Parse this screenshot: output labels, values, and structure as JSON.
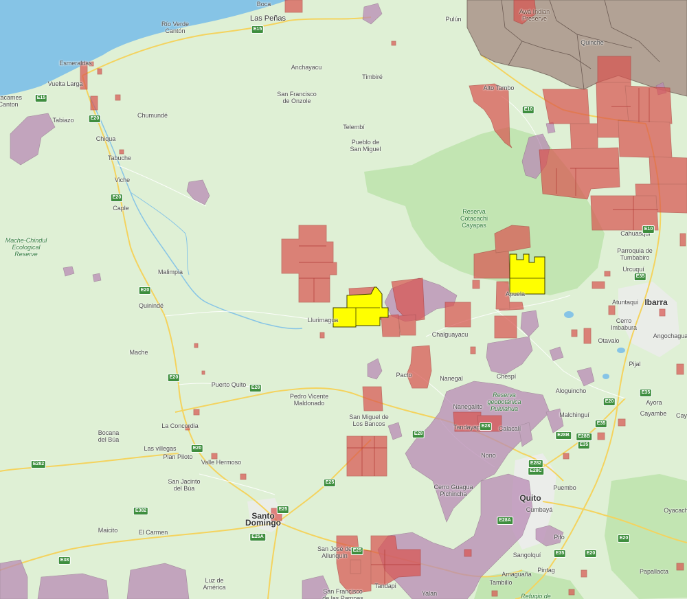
{
  "map": {
    "colors": {
      "land": "#dff0d5",
      "water": "#86c4e6",
      "park": "#bfe3ae",
      "road_major": "#f4d35e",
      "road_minor": "#ffffff",
      "mining_concession": "#d9534f",
      "protected_area": "#b98bb5",
      "indigenous_territory": "#a88f86",
      "highlight": "#ffff00",
      "urban": "#ececec"
    },
    "places": [
      {
        "text": "Las Peñas",
        "kind": "town"
      },
      {
        "text": "Río Verde\nCantón",
        "kind": "place"
      },
      {
        "text": "Esmeraldas",
        "kind": "place"
      },
      {
        "text": "Vuelta Larga",
        "kind": "place"
      },
      {
        "text": "Atacames\nCanton",
        "kind": "place"
      },
      {
        "text": "Tabiazo",
        "kind": "place"
      },
      {
        "text": "Chiqua",
        "kind": "place"
      },
      {
        "text": "Tabuche",
        "kind": "place"
      },
      {
        "text": "Viche",
        "kind": "place"
      },
      {
        "text": "Caple",
        "kind": "place"
      },
      {
        "text": "Anchayacu",
        "kind": "place"
      },
      {
        "text": "Timbiré",
        "kind": "place"
      },
      {
        "text": "San Francisco\nde Onzole",
        "kind": "place"
      },
      {
        "text": "Chumundé",
        "kind": "place"
      },
      {
        "text": "Telembí",
        "kind": "place"
      },
      {
        "text": "Pueblo de\nSan Miguel",
        "kind": "place"
      },
      {
        "text": "Pulún",
        "kind": "place"
      },
      {
        "text": "Quinche",
        "kind": "place"
      },
      {
        "text": "Alto Tambo",
        "kind": "place"
      },
      {
        "text": "Mache-Chindul\nEcological\nReserve",
        "kind": "reserve"
      },
      {
        "text": "Reserva\nCotacachi\nCayapas",
        "kind": "park"
      },
      {
        "text": "Malimpia",
        "kind": "place"
      },
      {
        "text": "Quinindé",
        "kind": "place"
      },
      {
        "text": "Llurimagua",
        "kind": "place"
      },
      {
        "text": "Apuela",
        "kind": "place"
      },
      {
        "text": "Chalguayacu",
        "kind": "place"
      },
      {
        "text": "Cahuasquí",
        "kind": "place"
      },
      {
        "text": "Parroquia de\nTumbabiro",
        "kind": "place"
      },
      {
        "text": "Urcuquí",
        "kind": "place"
      },
      {
        "text": "Atuntaqui",
        "kind": "place"
      },
      {
        "text": "Ibarra",
        "kind": "city"
      },
      {
        "text": "Cerro\nImbabura",
        "kind": "place"
      },
      {
        "text": "Angochagua",
        "kind": "place"
      },
      {
        "text": "Otavalo",
        "kind": "place"
      },
      {
        "text": "Mache",
        "kind": "place"
      },
      {
        "text": "Pacto",
        "kind": "place"
      },
      {
        "text": "Nanegal",
        "kind": "place"
      },
      {
        "text": "Chespí",
        "kind": "place"
      },
      {
        "text": "Pijal",
        "kind": "place"
      },
      {
        "text": "Puerto Quito",
        "kind": "place"
      },
      {
        "text": "Reserva\ngeobotánica\nPululahua",
        "kind": "reserve"
      },
      {
        "text": "Aloguincho",
        "kind": "place"
      },
      {
        "text": "Ayora",
        "kind": "place"
      },
      {
        "text": "Pedro Vicente\nMaldonado",
        "kind": "place"
      },
      {
        "text": "Nanegalito",
        "kind": "place"
      },
      {
        "text": "Malchinguí",
        "kind": "place"
      },
      {
        "text": "Cayambe",
        "kind": "place"
      },
      {
        "text": "La Concordia",
        "kind": "place"
      },
      {
        "text": "San Miguel de\nLos Bancos",
        "kind": "place"
      },
      {
        "text": "Tandayapa",
        "kind": "place"
      },
      {
        "text": "Calacalí",
        "kind": "place"
      },
      {
        "text": "Bocana\ndel Búa",
        "kind": "place"
      },
      {
        "text": "Las villegas",
        "kind": "place"
      },
      {
        "text": "Plan Piloto",
        "kind": "place"
      },
      {
        "text": "Valle Hermoso",
        "kind": "place"
      },
      {
        "text": "Nono",
        "kind": "place"
      },
      {
        "text": "San Jacinto\ndel Búa",
        "kind": "place"
      },
      {
        "text": "Cerro Guagua\nPichincha",
        "kind": "place"
      },
      {
        "text": "Quito",
        "kind": "city"
      },
      {
        "text": "Puembo",
        "kind": "place"
      },
      {
        "text": "Oyacachi",
        "kind": "place"
      },
      {
        "text": "Cumbayá",
        "kind": "place"
      },
      {
        "text": "Santo\nDomingo",
        "kind": "city"
      },
      {
        "text": "Maicito",
        "kind": "place"
      },
      {
        "text": "El Carmen",
        "kind": "place"
      },
      {
        "text": "Pifo",
        "kind": "place"
      },
      {
        "text": "San José de\nAlluriquín",
        "kind": "place"
      },
      {
        "text": "Sangolquí",
        "kind": "place"
      },
      {
        "text": "Pintag",
        "kind": "place"
      },
      {
        "text": "Amaguaña",
        "kind": "place"
      },
      {
        "text": "Papallacta",
        "kind": "place"
      },
      {
        "text": "Luz de\nAmérica",
        "kind": "place"
      },
      {
        "text": "Tandapi",
        "kind": "place"
      },
      {
        "text": "Tambillo",
        "kind": "place"
      },
      {
        "text": "Yalan",
        "kind": "place"
      },
      {
        "text": "San Francisco\nde las Pampas",
        "kind": "place"
      },
      {
        "text": "Refugio de",
        "kind": "reserve"
      },
      {
        "text": "Awá Indian\nPreserve",
        "kind": "preserve"
      },
      {
        "text": "Boca",
        "kind": "place"
      },
      {
        "text": "Cay",
        "kind": "place"
      }
    ],
    "shields": [
      "E15",
      "E15",
      "E20",
      "E10",
      "E20",
      "E20",
      "E20",
      "E20",
      "E10",
      "E35",
      "E35",
      "E28",
      "E28",
      "E28",
      "E20",
      "E35",
      "E28B",
      "E28B",
      "E282",
      "E25",
      "E282",
      "E28C",
      "E28A",
      "E25",
      "E382",
      "E25A",
      "E25",
      "E20",
      "E35",
      "E20",
      "E38",
      "E35"
    ]
  }
}
